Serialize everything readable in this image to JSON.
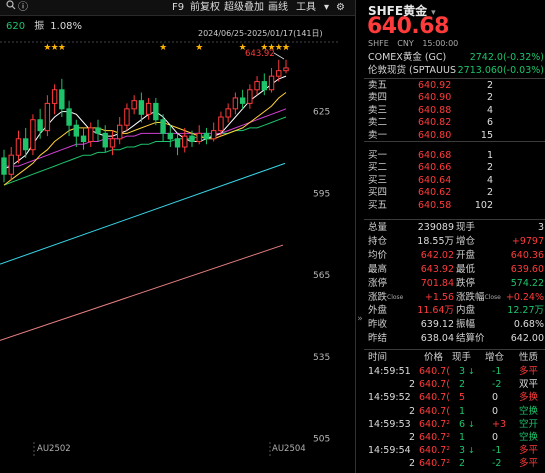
{
  "toolbar": {
    "f9": "F9",
    "adjust": "前复权",
    "overlay": "超级叠加",
    "draw": "画线",
    "tools": "工具",
    "search_icon": "search-icon",
    "info_icon": "info-icon"
  },
  "chart_info": {
    "ma_value": "620",
    "amplitude_label": "振",
    "amplitude_value": "1.08%",
    "date_range": "2024/06/25-2025/01/17(141日)",
    "high_marker": "643.92",
    "yaxis_labels": [
      "625",
      "595",
      "565",
      "535",
      "505"
    ],
    "contract_labels": [
      "AU2502",
      "AU2504"
    ]
  },
  "colors": {
    "up": "#ff3b3b",
    "down": "#1ec36a",
    "ma5": "#ffffff",
    "ma10": "#ffd13a",
    "ma20": "#d040d0",
    "ma60": "#1ec36a",
    "upper_trend": "#37d6e8",
    "lower_trend": "#e87f80"
  },
  "quote": {
    "symbol": "SHFE黄金",
    "price": "640.68",
    "exchange": "SHFE",
    "currency": "CNY",
    "time": "15:00:00",
    "refs": [
      {
        "name": "COMEX黄金 (GC)",
        "value": "2742.0",
        "change": "(-0.32%)"
      },
      {
        "name": "伦敦现货 (SPTAUUS",
        "value": "2713.060",
        "change": "(-0.03%)"
      }
    ]
  },
  "orderbook": {
    "asks": [
      {
        "label": "卖五",
        "price": "640.92",
        "qty": "2"
      },
      {
        "label": "卖四",
        "price": "640.90",
        "qty": "2"
      },
      {
        "label": "卖三",
        "price": "640.88",
        "qty": "4"
      },
      {
        "label": "卖二",
        "price": "640.82",
        "qty": "6"
      },
      {
        "label": "卖一",
        "price": "640.80",
        "qty": "15"
      }
    ],
    "bids": [
      {
        "label": "买一",
        "price": "640.68",
        "qty": "1"
      },
      {
        "label": "买二",
        "price": "640.66",
        "qty": "2"
      },
      {
        "label": "买三",
        "price": "640.64",
        "qty": "4"
      },
      {
        "label": "买四",
        "price": "640.62",
        "qty": "2"
      },
      {
        "label": "买五",
        "price": "640.58",
        "qty": "102"
      }
    ]
  },
  "stats": [
    {
      "l1": "总量",
      "v1": "239089",
      "c1": "white",
      "l2": "现手",
      "v2": "3",
      "c2": "white",
      "sup2": ""
    },
    {
      "l1": "持仓",
      "v1": "18.55万",
      "c1": "white",
      "l2": "增仓",
      "v2": "+9797",
      "c2": "red",
      "sup2": ""
    },
    {
      "l1": "均价",
      "v1": "642.02",
      "c1": "red",
      "l2": "开盘",
      "v2": "640.36",
      "c2": "red",
      "sup2": ""
    },
    {
      "l1": "最高",
      "v1": "643.92",
      "c1": "red",
      "l2": "最低",
      "v2": "639.60",
      "c2": "red",
      "sup2": ""
    },
    {
      "l1": "涨停",
      "v1": "701.84",
      "c1": "red",
      "l2": "跌停",
      "v2": "574.22",
      "c2": "green",
      "sup2": ""
    },
    {
      "l1": "涨跌",
      "v1": "+1.56",
      "c1": "red",
      "l2": "涨跌幅",
      "v2": "+0.24%",
      "c2": "red",
      "sup1": "Close",
      "sup2": "Close"
    },
    {
      "l1": "外盘",
      "v1": "11.64万",
      "c1": "red",
      "l2": "内盘",
      "v2": "12.27万",
      "c2": "green",
      "sup2": ""
    },
    {
      "l1": "昨收",
      "v1": "639.12",
      "c1": "white",
      "l2": "振幅",
      "v2": "0.68%",
      "c2": "white",
      "sup2": ""
    },
    {
      "l1": "昨结",
      "v1": "638.04",
      "c1": "white",
      "l2": "结算价",
      "v2": "642.00",
      "c2": "white",
      "sup2": ""
    }
  ],
  "ticks_header": [
    "时间",
    "价格",
    "现手",
    "增仓",
    "性质"
  ],
  "ticks": [
    {
      "time": "14:59:51",
      "price": "640.7(",
      "vol": "3",
      "arrow": "↓",
      "oi": "-1",
      "nature": "多平",
      "pc": "red",
      "vc": "green",
      "nc": "red"
    },
    {
      "time": "2",
      "price": "640.7(",
      "vol": "2",
      "arrow": "",
      "oi": "-2",
      "nature": "双平",
      "pc": "red",
      "vc": "green",
      "nc": "white"
    },
    {
      "time": "14:59:52",
      "price": "640.7(",
      "vol": "5",
      "arrow": "",
      "oi": "0",
      "nature": "多换",
      "pc": "red",
      "vc": "red",
      "nc": "red"
    },
    {
      "time": "2",
      "price": "640.7(",
      "vol": "1",
      "arrow": "",
      "oi": "0",
      "nature": "空换",
      "pc": "red",
      "vc": "green",
      "nc": "green"
    },
    {
      "time": "14:59:53",
      "price": "640.7²",
      "vol": "6",
      "arrow": "↓",
      "oi": "+3",
      "nature": "空开",
      "pc": "red",
      "vc": "green",
      "nc": "green"
    },
    {
      "time": "2",
      "price": "640.7²",
      "vol": "1",
      "arrow": "",
      "oi": "0",
      "nature": "空换",
      "pc": "red",
      "vc": "green",
      "nc": "green"
    },
    {
      "time": "14:59:54",
      "price": "640.7²",
      "vol": "3",
      "arrow": "↓",
      "oi": "-1",
      "nature": "多平",
      "pc": "red",
      "vc": "green",
      "nc": "red"
    },
    {
      "time": "2",
      "price": "640.7²",
      "vol": "2",
      "arrow": "",
      "oi": "-2",
      "nature": "多平",
      "pc": "red",
      "vc": "green",
      "nc": "red"
    }
  ],
  "chart_data": {
    "type": "candlestick",
    "ylim": [
      503,
      652
    ],
    "candles": [
      {
        "o": 608,
        "c": 602,
        "h": 611,
        "l": 599
      },
      {
        "o": 602,
        "c": 609,
        "h": 612,
        "l": 600
      },
      {
        "o": 609,
        "c": 615,
        "h": 618,
        "l": 606
      },
      {
        "o": 615,
        "c": 611,
        "h": 619,
        "l": 608
      },
      {
        "o": 611,
        "c": 622,
        "h": 624,
        "l": 609
      },
      {
        "o": 622,
        "c": 618,
        "h": 626,
        "l": 615
      },
      {
        "o": 618,
        "c": 628,
        "h": 631,
        "l": 616
      },
      {
        "o": 628,
        "c": 633,
        "h": 635,
        "l": 624
      },
      {
        "o": 633,
        "c": 626,
        "h": 637,
        "l": 623
      },
      {
        "o": 626,
        "c": 620,
        "h": 629,
        "l": 616
      },
      {
        "o": 620,
        "c": 616,
        "h": 622,
        "l": 612
      },
      {
        "o": 616,
        "c": 614,
        "h": 619,
        "l": 611
      },
      {
        "o": 614,
        "c": 619,
        "h": 621,
        "l": 612
      },
      {
        "o": 619,
        "c": 617,
        "h": 622,
        "l": 614
      },
      {
        "o": 617,
        "c": 612,
        "h": 620,
        "l": 610
      },
      {
        "o": 612,
        "c": 615,
        "h": 618,
        "l": 609
      },
      {
        "o": 615,
        "c": 620,
        "h": 623,
        "l": 613
      },
      {
        "o": 620,
        "c": 626,
        "h": 628,
        "l": 618
      },
      {
        "o": 626,
        "c": 629,
        "h": 631,
        "l": 624
      },
      {
        "o": 629,
        "c": 624,
        "h": 632,
        "l": 621
      },
      {
        "o": 624,
        "c": 628,
        "h": 630,
        "l": 622
      },
      {
        "o": 628,
        "c": 622,
        "h": 630,
        "l": 620
      },
      {
        "o": 622,
        "c": 617,
        "h": 624,
        "l": 614
      },
      {
        "o": 617,
        "c": 615,
        "h": 620,
        "l": 612
      },
      {
        "o": 615,
        "c": 612,
        "h": 617,
        "l": 609
      },
      {
        "o": 612,
        "c": 616,
        "h": 619,
        "l": 610
      },
      {
        "o": 616,
        "c": 614,
        "h": 618,
        "l": 612
      },
      {
        "o": 614,
        "c": 617,
        "h": 620,
        "l": 613
      },
      {
        "o": 617,
        "c": 615,
        "h": 619,
        "l": 613
      },
      {
        "o": 615,
        "c": 618,
        "h": 621,
        "l": 614
      },
      {
        "o": 618,
        "c": 623,
        "h": 625,
        "l": 616
      },
      {
        "o": 623,
        "c": 626,
        "h": 628,
        "l": 621
      },
      {
        "o": 626,
        "c": 630,
        "h": 632,
        "l": 624
      },
      {
        "o": 630,
        "c": 628,
        "h": 633,
        "l": 626
      },
      {
        "o": 628,
        "c": 633,
        "h": 635,
        "l": 626
      },
      {
        "o": 633,
        "c": 636,
        "h": 638,
        "l": 631
      },
      {
        "o": 636,
        "c": 633,
        "h": 639,
        "l": 631
      },
      {
        "o": 633,
        "c": 638,
        "h": 641,
        "l": 632
      },
      {
        "o": 638,
        "c": 640,
        "h": 644,
        "l": 636
      },
      {
        "o": 640,
        "c": 641,
        "h": 644,
        "l": 639
      }
    ],
    "ma5": [
      604,
      605,
      607,
      609,
      613,
      617,
      620,
      623,
      625,
      625,
      624,
      621,
      618,
      617,
      616,
      616,
      617,
      618,
      620,
      622,
      624,
      625,
      623,
      620,
      617,
      615,
      614,
      614,
      615,
      616,
      617,
      620,
      623,
      626,
      629,
      631,
      633,
      635,
      637,
      638
    ],
    "ma10": [
      598,
      600,
      602,
      604,
      606,
      609,
      611,
      614,
      616,
      618,
      619,
      619,
      619,
      619,
      618,
      618,
      617,
      617,
      618,
      619,
      620,
      621,
      621,
      620,
      619,
      618,
      617,
      616,
      615,
      615,
      616,
      617,
      618,
      619,
      621,
      623,
      625,
      627,
      630,
      632
    ],
    "ma20": [
      605,
      605,
      605,
      606,
      607,
      608,
      609,
      610,
      611,
      612,
      613,
      613,
      614,
      614,
      615,
      615,
      615,
      616,
      616,
      617,
      617,
      617,
      617,
      617,
      617,
      617,
      617,
      617,
      617,
      617,
      617,
      618,
      619,
      620,
      621,
      622,
      623,
      624,
      625,
      626
    ],
    "ma60": [
      598,
      599,
      600,
      601,
      602,
      603,
      604,
      605,
      606,
      607,
      608,
      609,
      609,
      610,
      610,
      611,
      611,
      612,
      612,
      613,
      613,
      614,
      614,
      614,
      615,
      615,
      615,
      616,
      616,
      616,
      617,
      617,
      618,
      618,
      619,
      619,
      620,
      621,
      622,
      623
    ],
    "upper_trend": [
      [
        0,
        569
      ],
      [
        355,
        606
      ]
    ],
    "lower_trend": [
      [
        0,
        541
      ],
      [
        283,
        576
      ]
    ]
  }
}
